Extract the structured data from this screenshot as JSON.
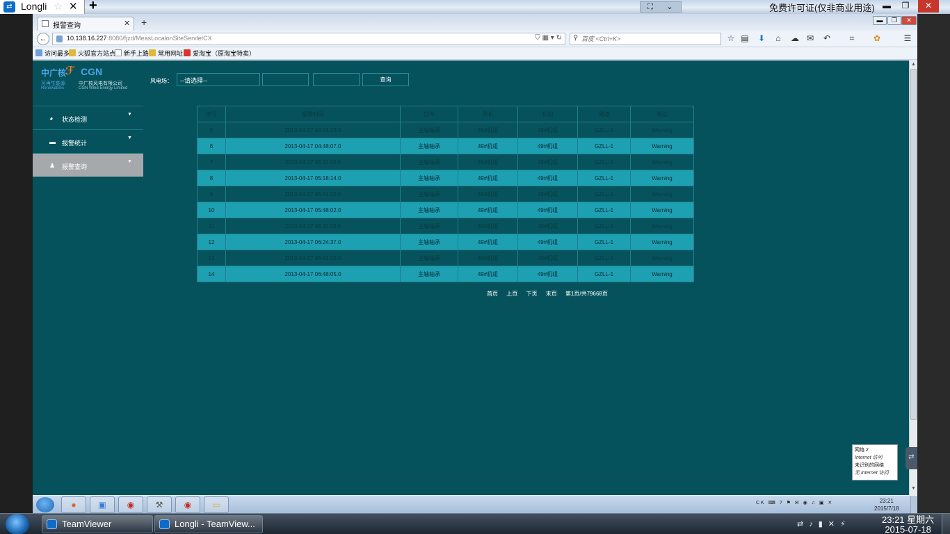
{
  "teamviewer": {
    "tab_title": "Longli",
    "tab_close": "✕",
    "new_tab": "+",
    "license_text": "免费许可证(仅非商业用途)",
    "fullscreen_icon": "⛶",
    "dropdown_icon": "⌄",
    "minimize": "▬",
    "restore": "❐",
    "close": "✕"
  },
  "browser": {
    "tab_title": "报警查询",
    "tab_close": "✕",
    "new_tab": "+",
    "url_host": "10.138.16.227",
    "url_rest": ":8080/fjzd/MeasLocalonSiteServletCX",
    "search_placeholder": "百度 <Ctrl+K>",
    "bookmarks": [
      "访问最多",
      "火狐官方站点",
      "新手上路",
      "常用网址",
      "爱淘宝（原淘宝特卖）"
    ]
  },
  "page": {
    "logo": {
      "cn": "中广核",
      "cgn": "CGN",
      "line1_left": "可再生能源",
      "line2_left": "Renewables",
      "line1_right": "中广核风电有限公司",
      "line2_right": "CGN Wind Energy Limited"
    },
    "menu": [
      {
        "label": "状态检测",
        "icon": "pie-icon"
      },
      {
        "label": "报警统计",
        "icon": "table-icon"
      },
      {
        "label": "报警查询",
        "icon": "user-icon"
      }
    ],
    "filter": {
      "label": "风电场：",
      "select_value": "--请选择--",
      "query_button": "查询"
    },
    "table": {
      "headers": [
        "序号",
        "报警时间",
        "部件",
        "风机",
        "机组",
        "通道",
        "级别"
      ],
      "rows": [
        [
          "5",
          "2013-04-17 04:41:03.0",
          "主轴轴承",
          "49#机组",
          "49#机组",
          "GZLL-1",
          "Warning"
        ],
        [
          "6",
          "2013-04-17 04:48:07.0",
          "主轴轴承",
          "49#机组",
          "49#机组",
          "GZLL-1",
          "Warning"
        ],
        [
          "7",
          "2013-04-17 05:11:04.0",
          "主轴轴承",
          "49#机组",
          "49#机组",
          "GZLL-1",
          "Warning"
        ],
        [
          "8",
          "2013-04-17 05:18:14.0",
          "主轴轴承",
          "49#机组",
          "49#机组",
          "GZLL-1",
          "Warning"
        ],
        [
          "9",
          "2013-04-17 05:41:02.0",
          "主轴轴承",
          "49#机组",
          "49#机组",
          "GZLL-1",
          "Warning"
        ],
        [
          "10",
          "2013-04-17 05:48:02.0",
          "主轴轴承",
          "49#机组",
          "49#机组",
          "GZLL-1",
          "Warning"
        ],
        [
          "11",
          "2013-04-17 06:11:03.0",
          "主轴轴承",
          "49#机组",
          "49#机组",
          "GZLL-1",
          "Warning"
        ],
        [
          "12",
          "2013-04-17 06:24:37.0",
          "主轴轴承",
          "49#机组",
          "49#机组",
          "GZLL-1",
          "Warning"
        ],
        [
          "13",
          "2013-04-17 06:41:05.0",
          "主轴轴承",
          "49#机组",
          "49#机组",
          "GZLL-1",
          "Warning"
        ],
        [
          "14",
          "2013-04-17 06:48:05.0",
          "主轴轴承",
          "49#机组",
          "49#机组",
          "GZLL-1",
          "Warning"
        ]
      ]
    },
    "pager": {
      "first": "首页",
      "prev": "上页",
      "next": "下页",
      "last": "末页",
      "info": "第1页/共79668页"
    }
  },
  "remote_taskbar": {
    "tray_text": "CK",
    "time": "23:21",
    "date": "2015/7/18",
    "network_popup": {
      "line1": "网络  2",
      "line2": "Internet 访问",
      "line3": "未识别的网络",
      "line4": "无 Internet 访问"
    }
  },
  "local_taskbar": {
    "tasks": [
      "TeamViewer",
      "Longli - TeamView..."
    ],
    "time": "23:21 星期六",
    "date": "2015-07-18"
  }
}
